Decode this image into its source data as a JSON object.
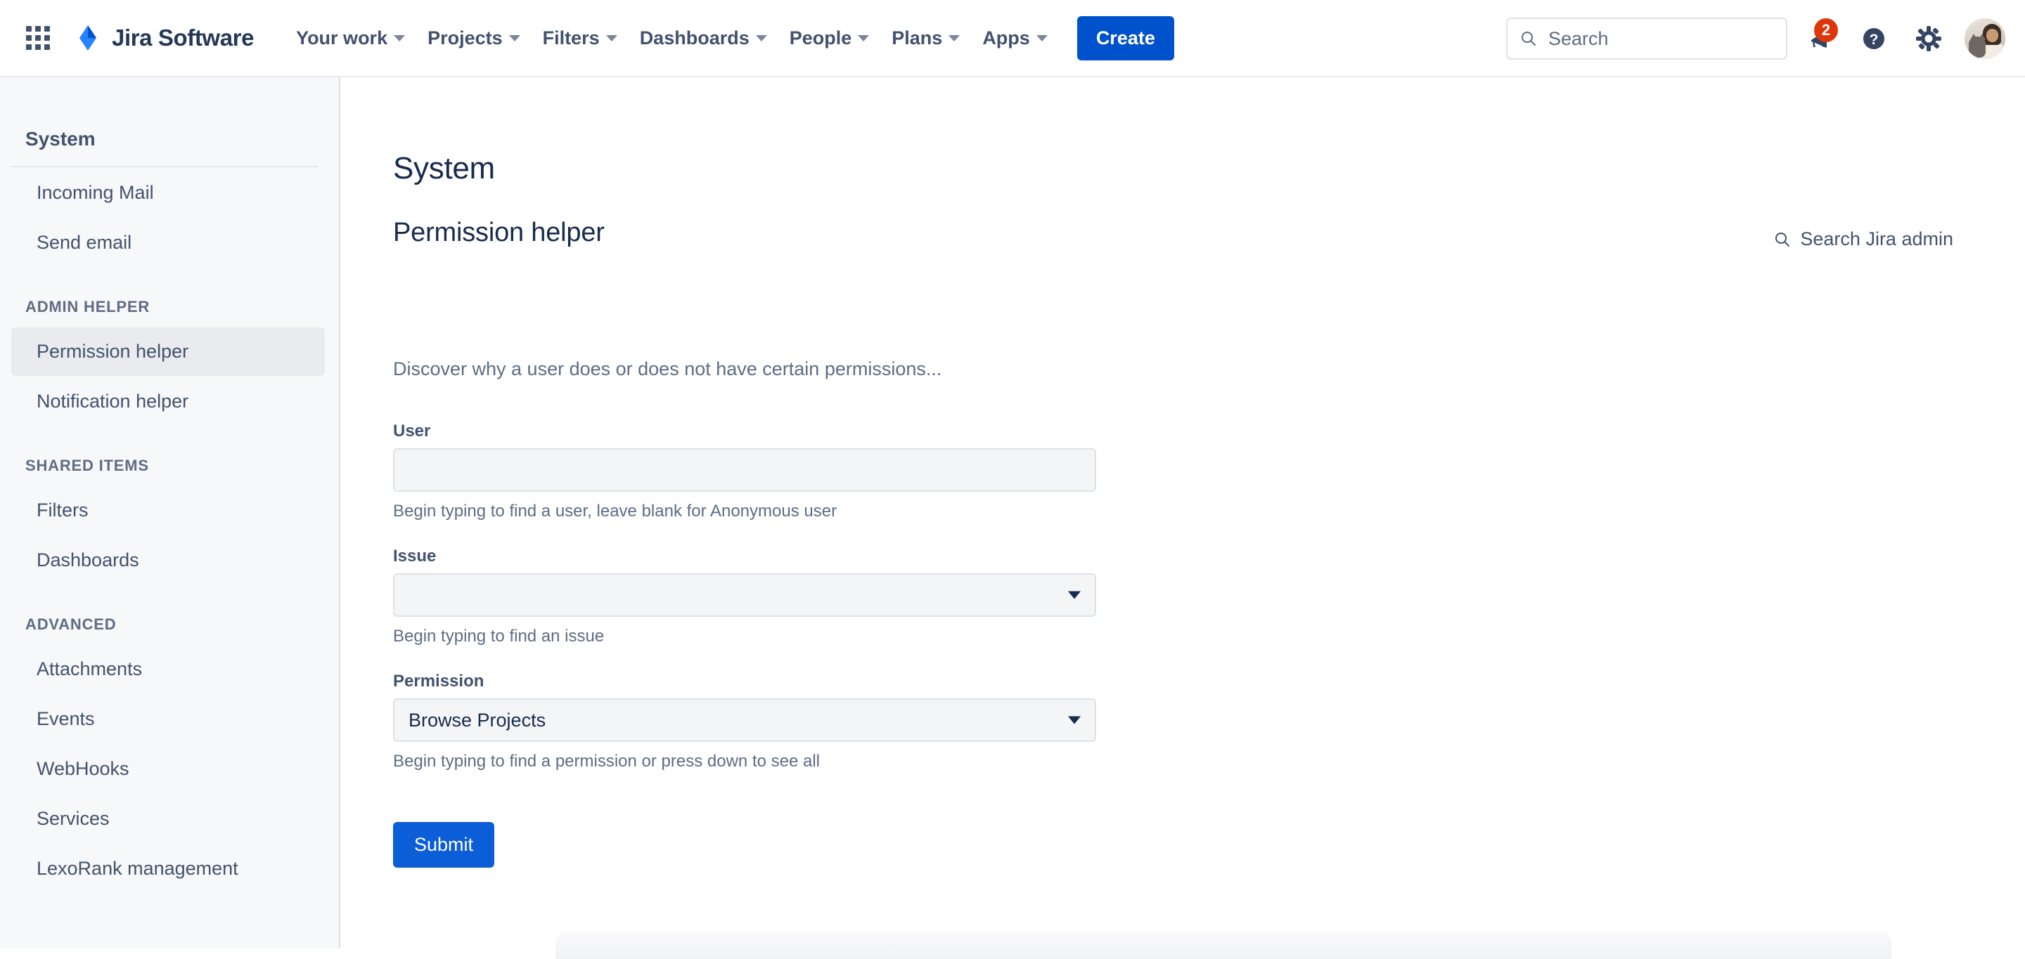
{
  "topnav": {
    "app_switcher_icon": "grid-apps-icon",
    "brand": {
      "logo_icon": "jira-diamond-logo",
      "name": "Jira Software"
    },
    "items": [
      {
        "label": "Your work",
        "icon": "chevron-down-icon"
      },
      {
        "label": "Projects",
        "icon": "chevron-down-icon"
      },
      {
        "label": "Filters",
        "icon": "chevron-down-icon"
      },
      {
        "label": "Dashboards",
        "icon": "chevron-down-icon"
      },
      {
        "label": "People",
        "icon": "chevron-down-icon"
      },
      {
        "label": "Plans",
        "icon": "chevron-down-icon"
      },
      {
        "label": "Apps",
        "icon": "chevron-down-icon"
      }
    ],
    "create_label": "Create",
    "search": {
      "placeholder": "Search",
      "value": "",
      "icon": "search-icon"
    },
    "notifications": {
      "icon": "megaphone-icon",
      "badge": "2"
    },
    "help": {
      "icon": "help-circle-icon"
    },
    "settings": {
      "icon": "gear-icon"
    },
    "avatar": {
      "icon": "user-avatar"
    }
  },
  "sidebar": {
    "title": "System",
    "groups": [
      {
        "section": null,
        "items": [
          {
            "label": "Incoming Mail",
            "selected": false
          },
          {
            "label": "Send email",
            "selected": false
          }
        ]
      },
      {
        "section": "ADMIN HELPER",
        "items": [
          {
            "label": "Permission helper",
            "selected": true
          },
          {
            "label": "Notification helper",
            "selected": false
          }
        ]
      },
      {
        "section": "SHARED ITEMS",
        "items": [
          {
            "label": "Filters",
            "selected": false
          },
          {
            "label": "Dashboards",
            "selected": false
          }
        ]
      },
      {
        "section": "ADVANCED",
        "items": [
          {
            "label": "Attachments",
            "selected": false
          },
          {
            "label": "Events",
            "selected": false
          },
          {
            "label": "WebHooks",
            "selected": false
          },
          {
            "label": "Services",
            "selected": false
          },
          {
            "label": "LexoRank management",
            "selected": false
          }
        ]
      }
    ]
  },
  "main": {
    "page_title": "System",
    "section_title": "Permission helper",
    "lede": "Discover why a user does or does not have certain permissions...",
    "admin_search": {
      "label": "Search Jira admin",
      "icon": "search-icon"
    },
    "form": {
      "user": {
        "label": "User",
        "value": "",
        "placeholder": "",
        "help": "Begin typing to find a user, leave blank for Anonymous user"
      },
      "issue": {
        "label": "Issue",
        "value": "",
        "options": [
          ""
        ],
        "help": "Begin typing to find an issue"
      },
      "permission": {
        "label": "Permission",
        "value": "Browse Projects",
        "options": [
          "Browse Projects"
        ],
        "help": "Begin typing to find a permission or press down to see all"
      },
      "submit_label": "Submit"
    }
  },
  "colors": {
    "brand_blue": "#0052CC",
    "submit_blue": "#0B5ED7",
    "badge_red": "#DE350B",
    "text_dark": "#172B4D",
    "text_muted": "#5E6C84",
    "sidebar_bg": "#F7F8F9",
    "selected_bg": "#E9EBEE"
  }
}
